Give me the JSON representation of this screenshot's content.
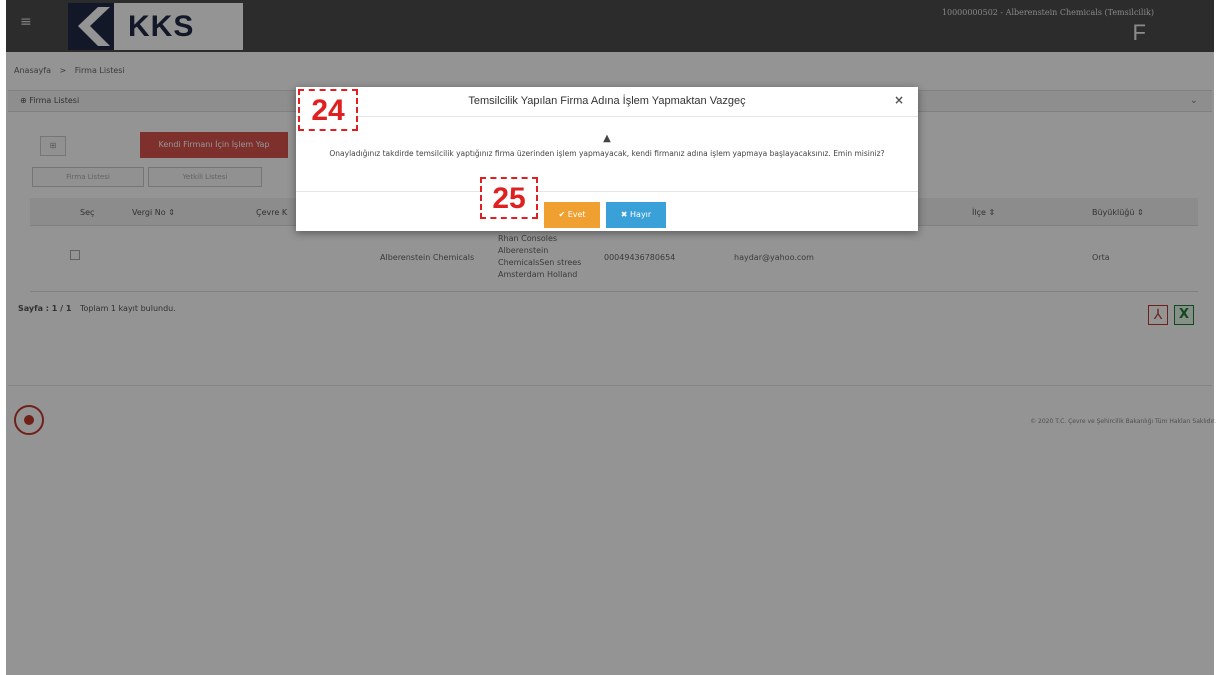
{
  "header": {
    "logo_text": "KKS",
    "user_info": "10000000502 - Alberenstein Chemicals (Temsilcilik)",
    "user_letter": "F"
  },
  "breadcrumb": {
    "home": "Anasayfa",
    "separator": ">",
    "current": "Firma Listesi"
  },
  "panel": {
    "title": "Firma Listesi",
    "own_company_button": "Kendi Firmanı İçin İşlem Yap",
    "small_button": "⊞",
    "pill_button_1": "Firma Listesi",
    "pill_button_2": "Yetkili Listesi"
  },
  "grid": {
    "columns": [
      "Seç",
      "Vergi No ⇕",
      "Çevre K",
      "İlçe ⇕",
      "Büyüklüğü ⇕"
    ],
    "rows": [
      {
        "name": "Alberenstein Chemicals",
        "address_1": "Rhan Consoles",
        "address_2": "Alberenstein",
        "address_3": "ChemicalsSen strees",
        "address_4": "Amsterdam Holland",
        "phone": "00049436780654",
        "email": "haydar@yahoo.com",
        "size": "Orta"
      }
    ]
  },
  "pager": {
    "page_label": "Sayfa : 1 / 1",
    "total": "Toplam 1 kayıt bulundu."
  },
  "footer": {
    "copyright": "© 2020 T.C. Çevre ve Şehircilik Bakanlığı Tüm Hakları Saklıdır."
  },
  "modal": {
    "title": "Temsilcilik Yapılan Firma Adına İşlem Yapmaktan Vazgeç",
    "close_glyph": "×",
    "warning_glyph": "▲",
    "message": "Onayladığınız takdirde temsilcilik yaptığınız firma üzerinden işlem yapmayacak, kendi firmanız adına işlem yapmaya başlayacaksınız. Emin misiniz?",
    "yes_label": "✔ Evet",
    "no_label": "✖ Hayır"
  },
  "annotations": {
    "step_24": "24",
    "step_25": "25"
  },
  "colors": {
    "header_bg": "#4d4d4d",
    "danger": "#d9534f",
    "yes_button": "#f0a030",
    "no_button": "#3aa0d8",
    "annotation": "#e02020"
  }
}
